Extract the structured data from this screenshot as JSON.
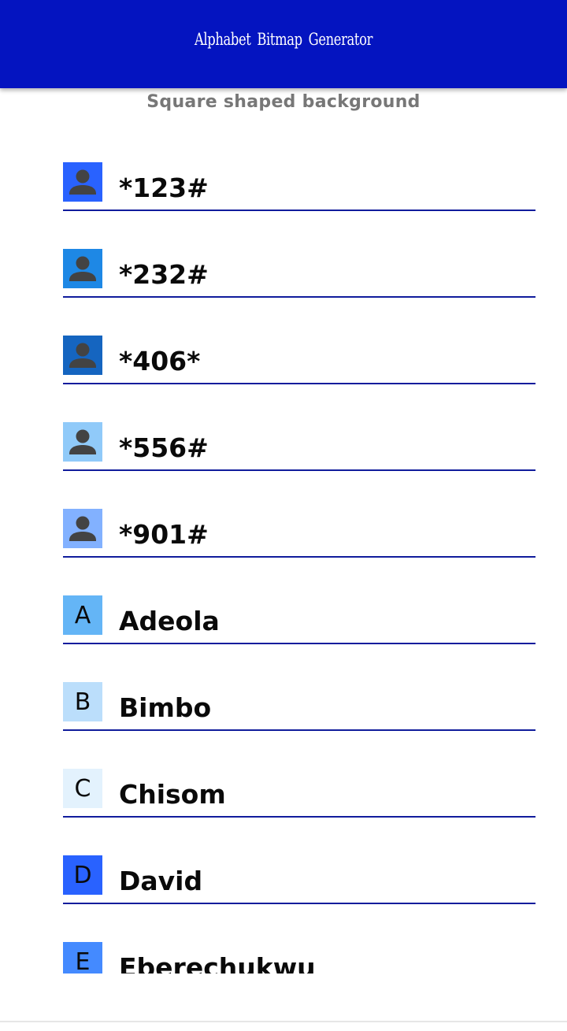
{
  "app_bar": {
    "title": "Alphabet Bitmap Generator",
    "background_color": "#0414c0"
  },
  "subtitle": "Square shaped background",
  "divider_color": "#101c9c",
  "items": [
    {
      "name": "*123#",
      "type": "icon",
      "icon": "person-icon",
      "tile_color": "#2962ff"
    },
    {
      "name": "*232#",
      "type": "icon",
      "icon": "person-icon",
      "tile_color": "#1e88e5"
    },
    {
      "name": "*406*",
      "type": "icon",
      "icon": "person-icon",
      "tile_color": "#1565c0"
    },
    {
      "name": "*556#",
      "type": "icon",
      "icon": "person-icon",
      "tile_color": "#90caf9"
    },
    {
      "name": "*901#",
      "type": "icon",
      "icon": "person-icon",
      "tile_color": "#82b1ff"
    },
    {
      "name": "Adeola",
      "type": "letter",
      "letter": "A",
      "tile_color": "#64b5f6"
    },
    {
      "name": "Bimbo",
      "type": "letter",
      "letter": "B",
      "tile_color": "#bbdefb"
    },
    {
      "name": "Chisom",
      "type": "letter",
      "letter": "C",
      "tile_color": "#e3f2fd"
    },
    {
      "name": "David",
      "type": "letter",
      "letter": "D",
      "tile_color": "#2962ff"
    },
    {
      "name": "Eberechukwu",
      "type": "letter",
      "letter": "E",
      "tile_color": "#448aff"
    }
  ]
}
